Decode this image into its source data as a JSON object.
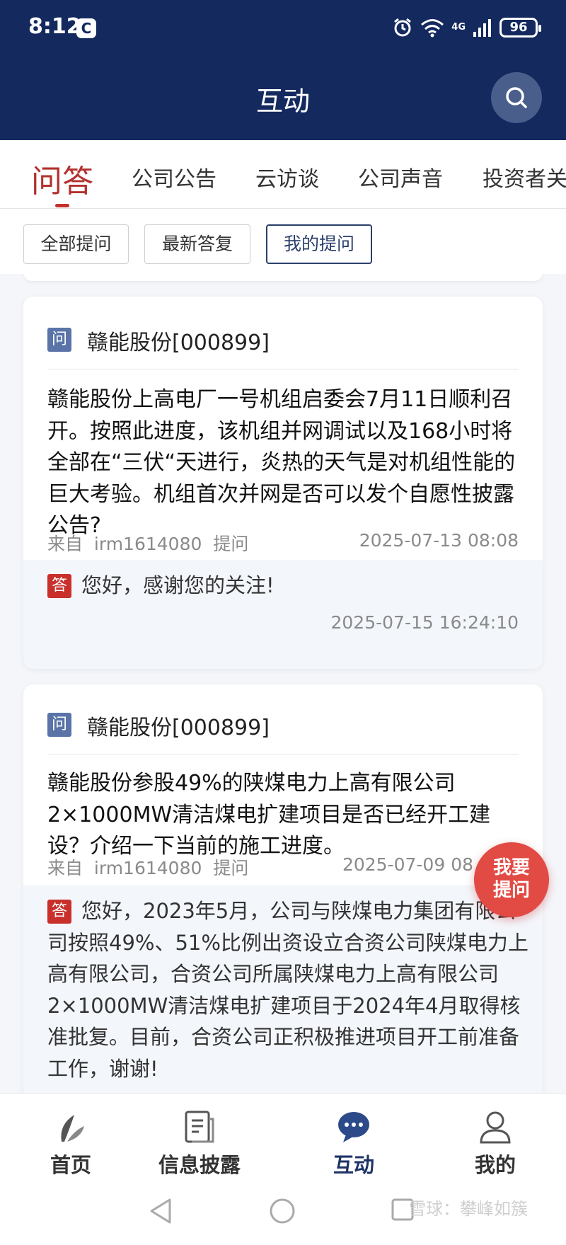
{
  "status_bar": {
    "time": "8:12",
    "battery": "96",
    "network": "4G"
  },
  "header": {
    "title": "互动"
  },
  "tabs": [
    {
      "label": "问答",
      "active": true
    },
    {
      "label": "公司公告"
    },
    {
      "label": "云访谈"
    },
    {
      "label": "公司声音"
    },
    {
      "label": "投资者关"
    }
  ],
  "filters": [
    {
      "label": "全部提问"
    },
    {
      "label": "最新答复"
    },
    {
      "label": "我的提问",
      "active": true
    }
  ],
  "cards": [
    {
      "q_badge": "问",
      "company": "赣能股份[000899]",
      "question": "赣能股份上高电厂一号机组启委会7月11日顺利召开。按照此进度，该机组并网调试以及168小时将全部在“三伏“天进行，炎热的天气是对机组性能的巨大考验。机组首次并网是否可以发个自愿性披露公告?",
      "from_label": "来自",
      "user": "irm1614080",
      "ask_label": "提问",
      "date": "2025-07-13 08:08",
      "a_badge": "答",
      "answer": "您好，感谢您的关注!",
      "answer_date": "2025-07-15 16:24:10"
    },
    {
      "q_badge": "问",
      "company": "赣能股份[000899]",
      "question": "赣能股份参股49%的陕煤电力上高有限公司2×1000MW清洁煤电扩建项目是否已经开工建设？介绍一下当前的施工进度。",
      "from_label": "来自",
      "user": "irm1614080",
      "ask_label": "提问",
      "date": "2025-07-09 08",
      "a_badge": "答",
      "answer": "您好，2023年5月，公司与陕煤电力集团有限公司按照49%、51%比例出资设立合资公司陕煤电力上高有限公司，合资公司所属陕煤电力上高有限公司2×1000MW清洁煤电扩建项目于2024年4月取得核准批复。目前，合资公司正积极推进项目开工前准备工作，谢谢!"
    }
  ],
  "fab": {
    "line1": "我要",
    "line2": "提问"
  },
  "bottom_nav": [
    {
      "label": "首页",
      "icon": "leaf-icon"
    },
    {
      "label": "信息披露",
      "icon": "document-icon"
    },
    {
      "label": "互动",
      "icon": "chat-icon",
      "active": true
    },
    {
      "label": "我的",
      "icon": "user-icon"
    }
  ],
  "watermark": "雪球：攀峰如簇"
}
